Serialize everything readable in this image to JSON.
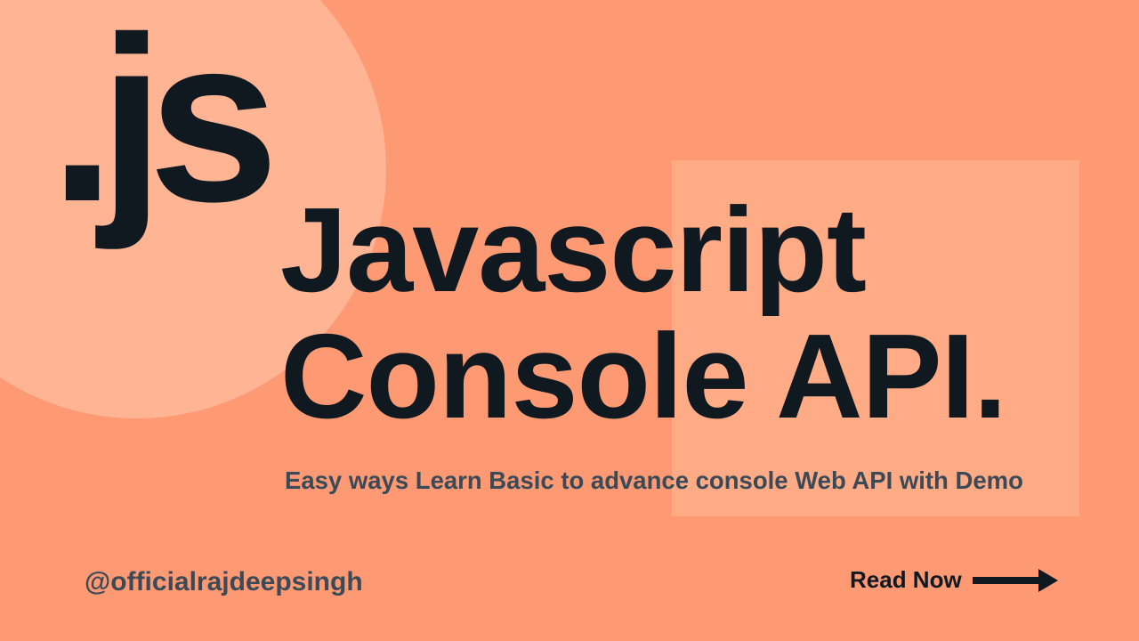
{
  "logo": ".js",
  "headline_line1": "Javascript",
  "headline_line2": "Console API.",
  "subtitle": "Easy ways  Learn Basic to advance console Web API with Demo",
  "handle": "@officialrajdeepsingh",
  "cta_label": "Read Now",
  "colors": {
    "background": "#fd9a74",
    "circle": "#ffb494",
    "rect": "#feab86",
    "heading": "#101820",
    "subtext": "#3b4a56"
  }
}
